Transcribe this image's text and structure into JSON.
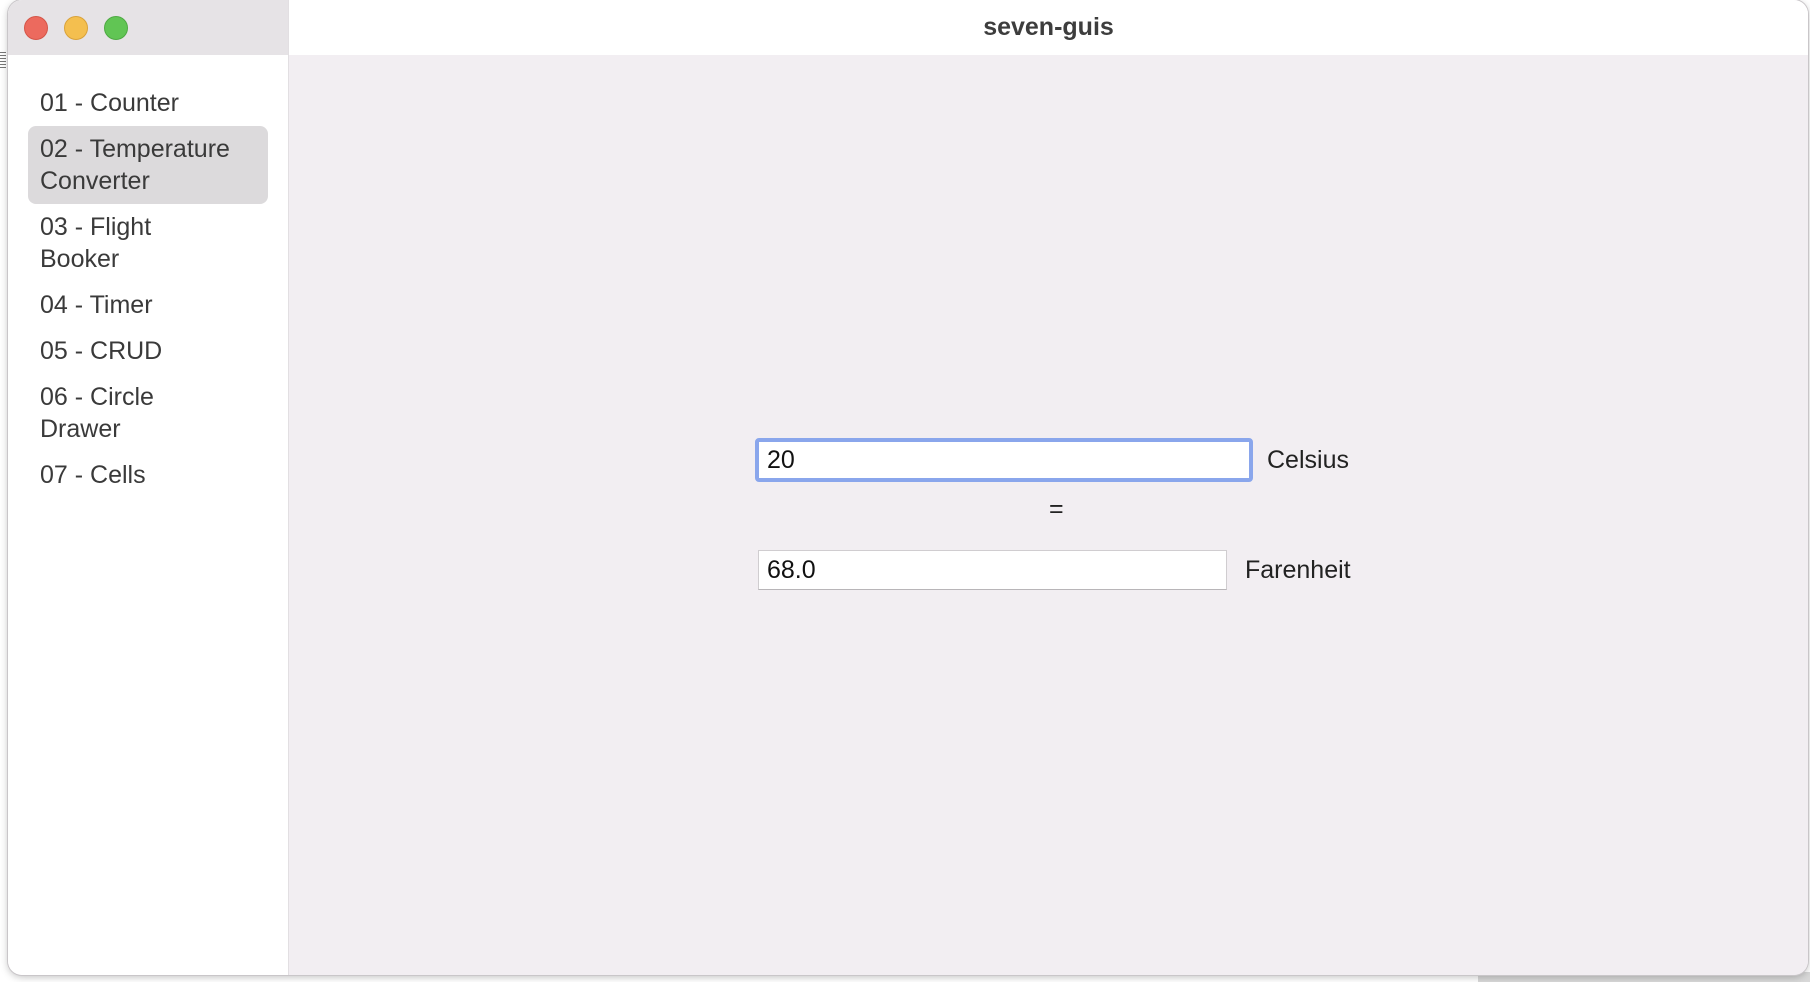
{
  "window": {
    "title": "seven-guis"
  },
  "sidebar": {
    "items": [
      {
        "line1": "01 - Counter",
        "line2": ""
      },
      {
        "line1": "02 - Temperature",
        "line2": "Converter"
      },
      {
        "line1": "03 - Flight",
        "line2": "Booker"
      },
      {
        "line1": "04 - Timer",
        "line2": ""
      },
      {
        "line1": "05 - CRUD",
        "line2": ""
      },
      {
        "line1": "06 - Circle",
        "line2": "Drawer"
      },
      {
        "line1": "07 - Cells",
        "line2": ""
      }
    ],
    "selected_index": 1
  },
  "converter": {
    "celsius_value": "20",
    "celsius_label": "Celsius",
    "equals": "=",
    "fahrenheit_value": "68.0",
    "fahrenheit_label": "Farenheit"
  },
  "colors": {
    "focus_ring": "#8aa6ec",
    "selected_item_bg": "#dcdadc",
    "content_bg": "#f2eef2",
    "close": "#ec6a5e",
    "minimize": "#f4bf4f",
    "maximize": "#61c554"
  }
}
